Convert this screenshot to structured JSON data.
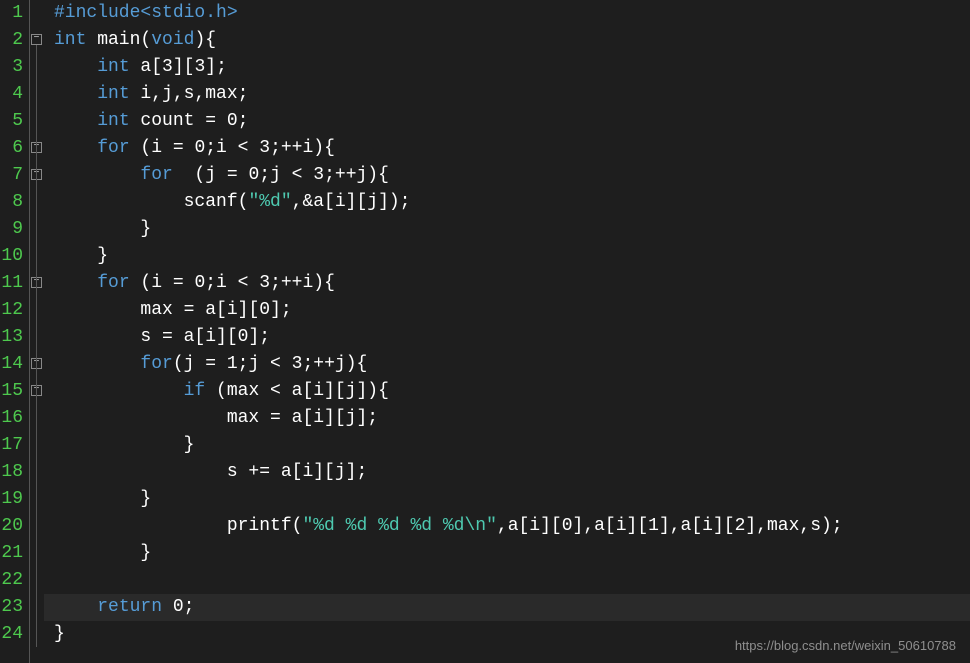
{
  "lineNumbers": [
    "1",
    "2",
    "3",
    "4",
    "5",
    "6",
    "7",
    "8",
    "9",
    "10",
    "11",
    "12",
    "13",
    "14",
    "15",
    "16",
    "17",
    "18",
    "19",
    "20",
    "21",
    "22",
    "23",
    "24"
  ],
  "foldMarkers": [
    {
      "line": 2
    },
    {
      "line": 6
    },
    {
      "line": 7
    },
    {
      "line": 11
    },
    {
      "line": 14
    },
    {
      "line": 15
    }
  ],
  "code": {
    "line1": {
      "include": "#include",
      "header": "<stdio.h>"
    },
    "line2": {
      "kw1": "int",
      "fn": " main(",
      "kw2": "void",
      "rest": "){"
    },
    "line3": {
      "indent": "    ",
      "kw": "int",
      "rest": " a[",
      "n1": "3",
      "mid": "][",
      "n2": "3",
      "end": "];"
    },
    "line4": {
      "indent": "    ",
      "kw": "int",
      "rest": " i,j,s,max;"
    },
    "line5": {
      "indent": "    ",
      "kw": "int",
      "rest": " count = ",
      "n": "0",
      "end": ";"
    },
    "line6": {
      "indent": "    ",
      "kw": "for",
      "rest": " (i = ",
      "n1": "0",
      "mid1": ";i < ",
      "n2": "3",
      "mid2": ";++i){"
    },
    "line7": {
      "indent": "        ",
      "kw": "for",
      "rest": "  (j = ",
      "n1": "0",
      "mid1": ";j < ",
      "n2": "3",
      "mid2": ";++j){"
    },
    "line8": {
      "indent": "            ",
      "fn": "scanf(",
      "str": "\"%d\"",
      "rest": ",&a[i][j]);"
    },
    "line9": {
      "indent": "        ",
      "rest": "}"
    },
    "line10": {
      "indent": "    ",
      "rest": "}"
    },
    "line11": {
      "indent": "    ",
      "kw": "for",
      "rest": " (i = ",
      "n1": "0",
      "mid1": ";i < ",
      "n2": "3",
      "mid2": ";++i){"
    },
    "line12": {
      "indent": "        ",
      "rest": "max = a[i][",
      "n": "0",
      "end": "];"
    },
    "line13": {
      "indent": "        ",
      "rest": "s = a[i][",
      "n": "0",
      "end": "];"
    },
    "line14": {
      "indent": "        ",
      "kw": "for",
      "rest": "(j = ",
      "n1": "1",
      "mid1": ";j < ",
      "n2": "3",
      "mid2": ";++j){"
    },
    "line15": {
      "indent": "            ",
      "kw": "if",
      "rest": " (max < a[i][j]){"
    },
    "line16": {
      "indent": "                ",
      "rest": "max = a[i][j];"
    },
    "line17": {
      "indent": "            ",
      "rest": "}"
    },
    "line18": {
      "indent": "                ",
      "rest": "s += a[i][j];"
    },
    "line19": {
      "indent": "        ",
      "rest": "}"
    },
    "line20": {
      "indent": "                ",
      "fn": "printf(",
      "str": "\"%d %d %d %d %d\\n\"",
      "rest": ",a[i][",
      "n1": "0",
      "m1": "],a[i][",
      "n2": "1",
      "m2": "],a[i][",
      "n3": "2",
      "end": "],max,s);"
    },
    "line21": {
      "indent": "        ",
      "rest": "}"
    },
    "line22": {
      "rest": ""
    },
    "line23": {
      "indent": "    ",
      "kw": "return",
      "rest": " ",
      "n": "0",
      "end": ";"
    },
    "line24": {
      "rest": "}"
    }
  },
  "watermark": "https://blog.csdn.net/weixin_50610788",
  "currentLine": 23
}
